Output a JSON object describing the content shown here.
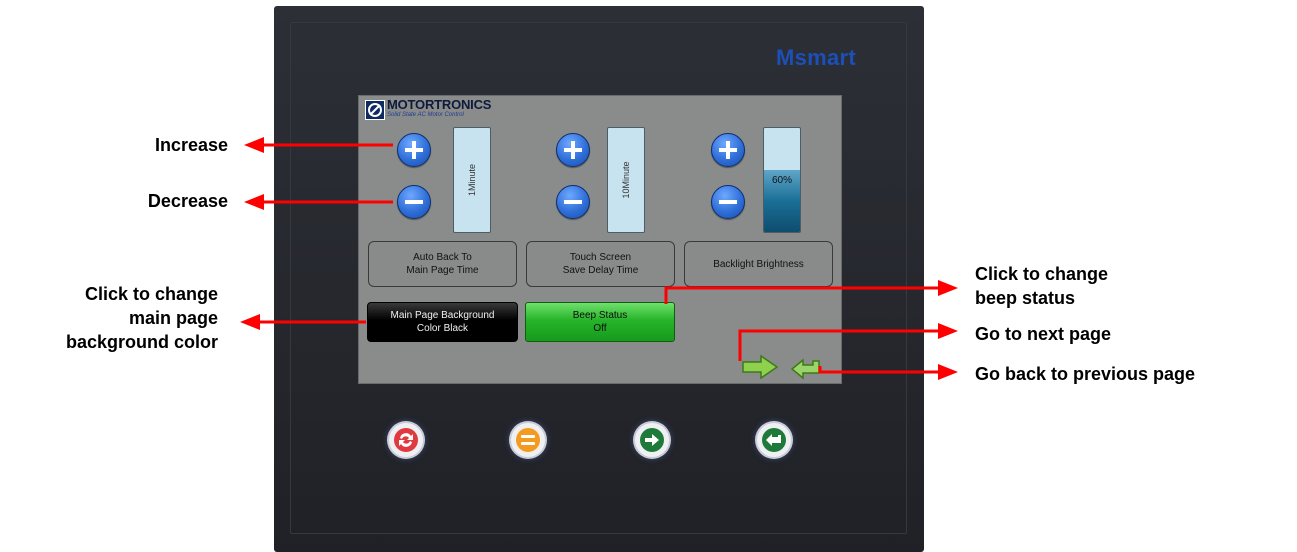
{
  "device": {
    "brand": "Msmart"
  },
  "screen": {
    "logo_name": "MOTORTRONICS",
    "logo_subtitle": "Solid State AC Motor Control",
    "controls": [
      {
        "value_text": "1Minute",
        "label_line1": "Auto Back To",
        "label_line2": "Main Page Time"
      },
      {
        "value_text": "10Minute",
        "label_line1": "Touch Screen",
        "label_line2": "Save Delay Time"
      },
      {
        "value_text": "60%",
        "fill_percent": 60,
        "label_line1": "Backlight Brightness",
        "label_line2": ""
      }
    ],
    "bg_button": {
      "line1": "Main Page Background",
      "line2": "Color Black"
    },
    "beep_button": {
      "line1": "Beep Status",
      "line2": "Off"
    }
  },
  "annotations": {
    "increase": "Increase",
    "decrease": "Decrease",
    "bg_line1": "Click to change",
    "bg_line2": "main page",
    "bg_line3": "background color",
    "beep_line1": "Click to change",
    "beep_line2": "beep status",
    "next_page": "Go to next page",
    "prev_page": "Go back to previous page"
  },
  "hardware_keys": [
    "refresh-icon",
    "menu-icon",
    "arrow-right-icon",
    "arrow-back-icon"
  ],
  "colors": {
    "brand": "#1d4fb8",
    "annotation_arrow": "#ff0000",
    "beep_button": "#27b42a",
    "screen_bg": "#8a8b8b"
  }
}
